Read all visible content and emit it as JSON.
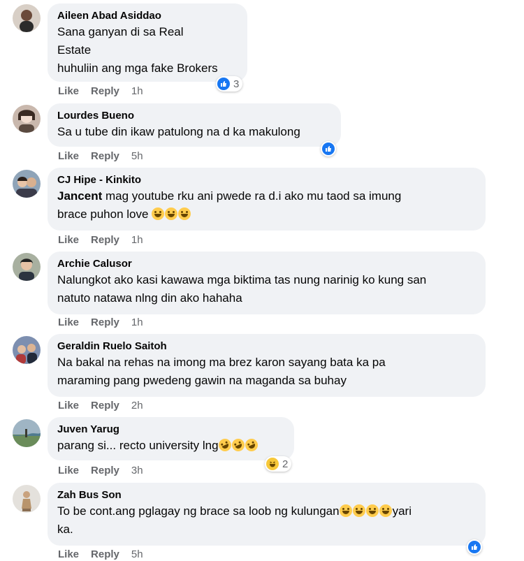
{
  "labels": {
    "like": "Like",
    "reply": "Reply"
  },
  "colors": {
    "bubble": "#f0f2f5",
    "meta": "#65676b",
    "like_blue": "#1877f2",
    "haha_yellow": "#f7c83a"
  },
  "comments": [
    {
      "author": "Aileen Abad Asiddao",
      "text": "Sana ganyan di sa Real\nEstate\nhuhuliin ang mga fake Brokers",
      "time": "1h",
      "reactions": {
        "icons": [
          "like-icon"
        ],
        "count": "3"
      }
    },
    {
      "author": "Lourdes Bueno",
      "text": "Sa u tube din ikaw patulong na d ka makulong",
      "time": "5h",
      "reactions": {
        "icons": [
          "like-icon"
        ],
        "count": ""
      }
    },
    {
      "author": "CJ Hipe - Kinkito",
      "tag": "Jancent",
      "text": " mag youtube rku ani pwede ra d.i ako mu taod sa imung\nbrace puhon love",
      "emojis": [
        "joy-emoji",
        "joy-emoji",
        "joy-emoji"
      ],
      "time": "1h"
    },
    {
      "author": "Archie Calusor",
      "text": "Nalungkot ako kasi kawawa mga biktima tas nung narinig ko kung san\nnatuto natawa nlng din ako hahaha",
      "time": "1h"
    },
    {
      "author": "Geraldin Ruelo Saitoh",
      "text": "Na bakal na rehas na imong ma brez karon sayang bata ka pa\nmaraming pang pwedeng gawin na maganda sa buhay",
      "time": "2h"
    },
    {
      "author": "Juven Yarug",
      "text": "parang si... recto university lng",
      "emojis": [
        "rofl-emoji",
        "rofl-emoji",
        "rofl-emoji"
      ],
      "time": "3h",
      "reactions": {
        "icons": [
          "haha-icon"
        ],
        "count": "2"
      }
    },
    {
      "author": "Zah Bus Son",
      "text": "To be cont.ang pglagay ng brace sa loob ng kulungan",
      "emojis": [
        "joy-emoji",
        "joy-emoji",
        "joy-emoji",
        "joy-emoji"
      ],
      "text_after": "yari\nka.",
      "time": "5h",
      "reactions": {
        "icons": [
          "like-icon"
        ],
        "count": ""
      }
    }
  ]
}
